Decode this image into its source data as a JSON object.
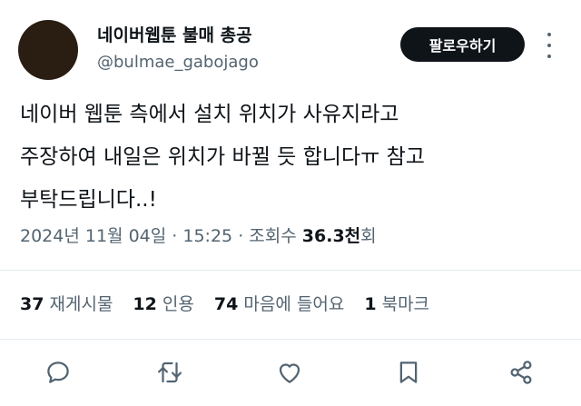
{
  "author": {
    "display_name": "네이버웹툰 불매 총공",
    "handle": "@bulmae_gabojago"
  },
  "follow_button": {
    "label": "팔로우하기"
  },
  "tweet": {
    "lines": [
      "네이버 웹툰 측에서 설치 위치가 사유지라고",
      "주장하여 내일은 위치가 바뀔 듯 합니다ㅠ 참고",
      "부탁드립니다..!"
    ]
  },
  "meta": {
    "date": "2024년 11월 04일",
    "sep1": "·",
    "time": "15:25",
    "sep2": "·",
    "views_label": "조회수",
    "views_value": "36.3천",
    "views_suffix": "회"
  },
  "stats": [
    {
      "count": "37",
      "label": "재게시물"
    },
    {
      "count": "12",
      "label": "인용"
    },
    {
      "count": "74",
      "label": "마음에 들어요"
    },
    {
      "count": "1",
      "label": "북마크"
    }
  ],
  "actions": {
    "reply": "reply-icon",
    "repost": "repost-icon",
    "like": "heart-icon",
    "bookmark": "bookmark-icon",
    "share": "share-icon"
  }
}
